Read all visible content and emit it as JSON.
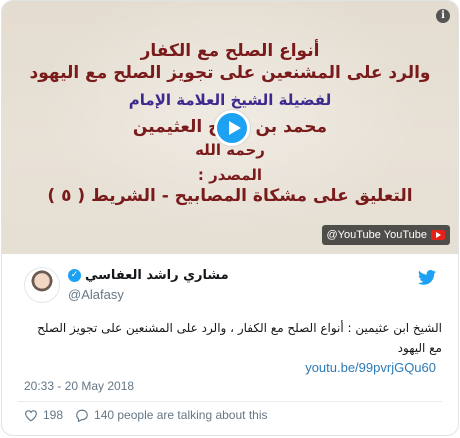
{
  "video": {
    "lines": [
      "أنواع الصلح مع الكفار",
      "والرد على المشنعين على تجويز الصلح مع اليهود",
      "لفضيلة الشيخ العلامة الإمام",
      "محمد بن صالح العثيمين",
      "رحمه الله",
      "المصدر :",
      "التعليق على مشكاة المصابيح - الشريط ( ٥ )"
    ],
    "badge_text": "@YouTube YouTube",
    "info_label": "i"
  },
  "tweet": {
    "author_name": "مشاري راشد العفاسي",
    "handle": "@Alafasy",
    "text": "الشيخ ابن عثيمين : أنواع الصلح مع الكفار ، والرد على المشنعين على تجويز الصلح مع اليهود",
    "link": "youtu.be/99pvrjGQu60",
    "timestamp": "20:33 - 20 May 2018",
    "likes": "198",
    "conversation": "140 people are talking about this"
  },
  "colors": {
    "accent": "#1da1f2",
    "link": "#2b7bb9",
    "muted": "#657786",
    "title_red": "#7a1b1b"
  },
  "icons": [
    "play-icon",
    "info-icon",
    "youtube-logo-icon",
    "verified-icon",
    "twitter-bird-icon",
    "heart-icon",
    "reply-bubble-icon"
  ]
}
